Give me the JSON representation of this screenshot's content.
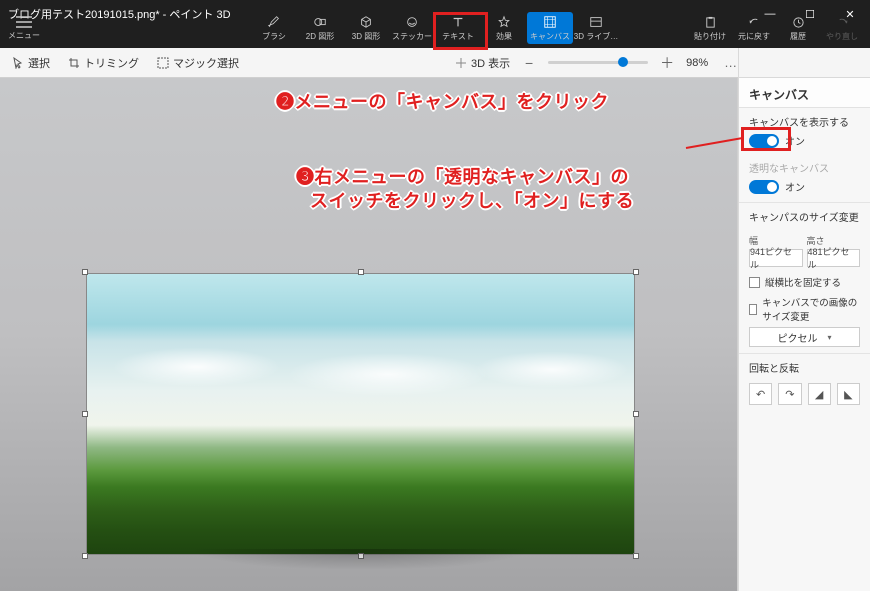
{
  "window": {
    "title": "ブログ用テスト20191015.png* - ペイント 3D",
    "menu_label": "メニュー"
  },
  "tabs": {
    "brush": "ブラシ",
    "shape2d": "2D 図形",
    "shape3d": "3D 図形",
    "sticker": "ステッカー",
    "text": "テキスト",
    "effects": "効果",
    "canvas": "キャンバス",
    "library": "3D ライブ…"
  },
  "ribbon_right": {
    "paste": "貼り付け",
    "undo": "元に戻す",
    "history": "履歴",
    "redo": "やり直し"
  },
  "toolbar": {
    "select": "選択",
    "crop": "トリミング",
    "magic": "マジック選択",
    "view3d": "3D 表示",
    "zoom_minus": "−",
    "zoom_plus": "＋",
    "zoom_pct": "98%",
    "more": "…"
  },
  "panel": {
    "title": "キャンバス",
    "show_canvas_label": "キャンバスを表示する",
    "show_on": "オン",
    "transparent_label": "透明なキャンバス",
    "transparent_on": "オン",
    "resize_title": "キャンパスのサイズ変更",
    "width_label": "幅",
    "height_label": "高さ",
    "width_val": "941ピクセル",
    "height_val": "481ピクセル",
    "lock_aspect": "縦横比を固定する",
    "resize_img": "キャンバスでの画像のサイズ変更",
    "unit": "ピクセル",
    "rotate_title": "回転と反転"
  },
  "annotations": {
    "step2": "❷メニューの「キャンバス」をクリック",
    "step3a": "❸右メニューの「透明なキャンバス」の",
    "step3b": "スイッチをクリックし、「オン」にする"
  }
}
